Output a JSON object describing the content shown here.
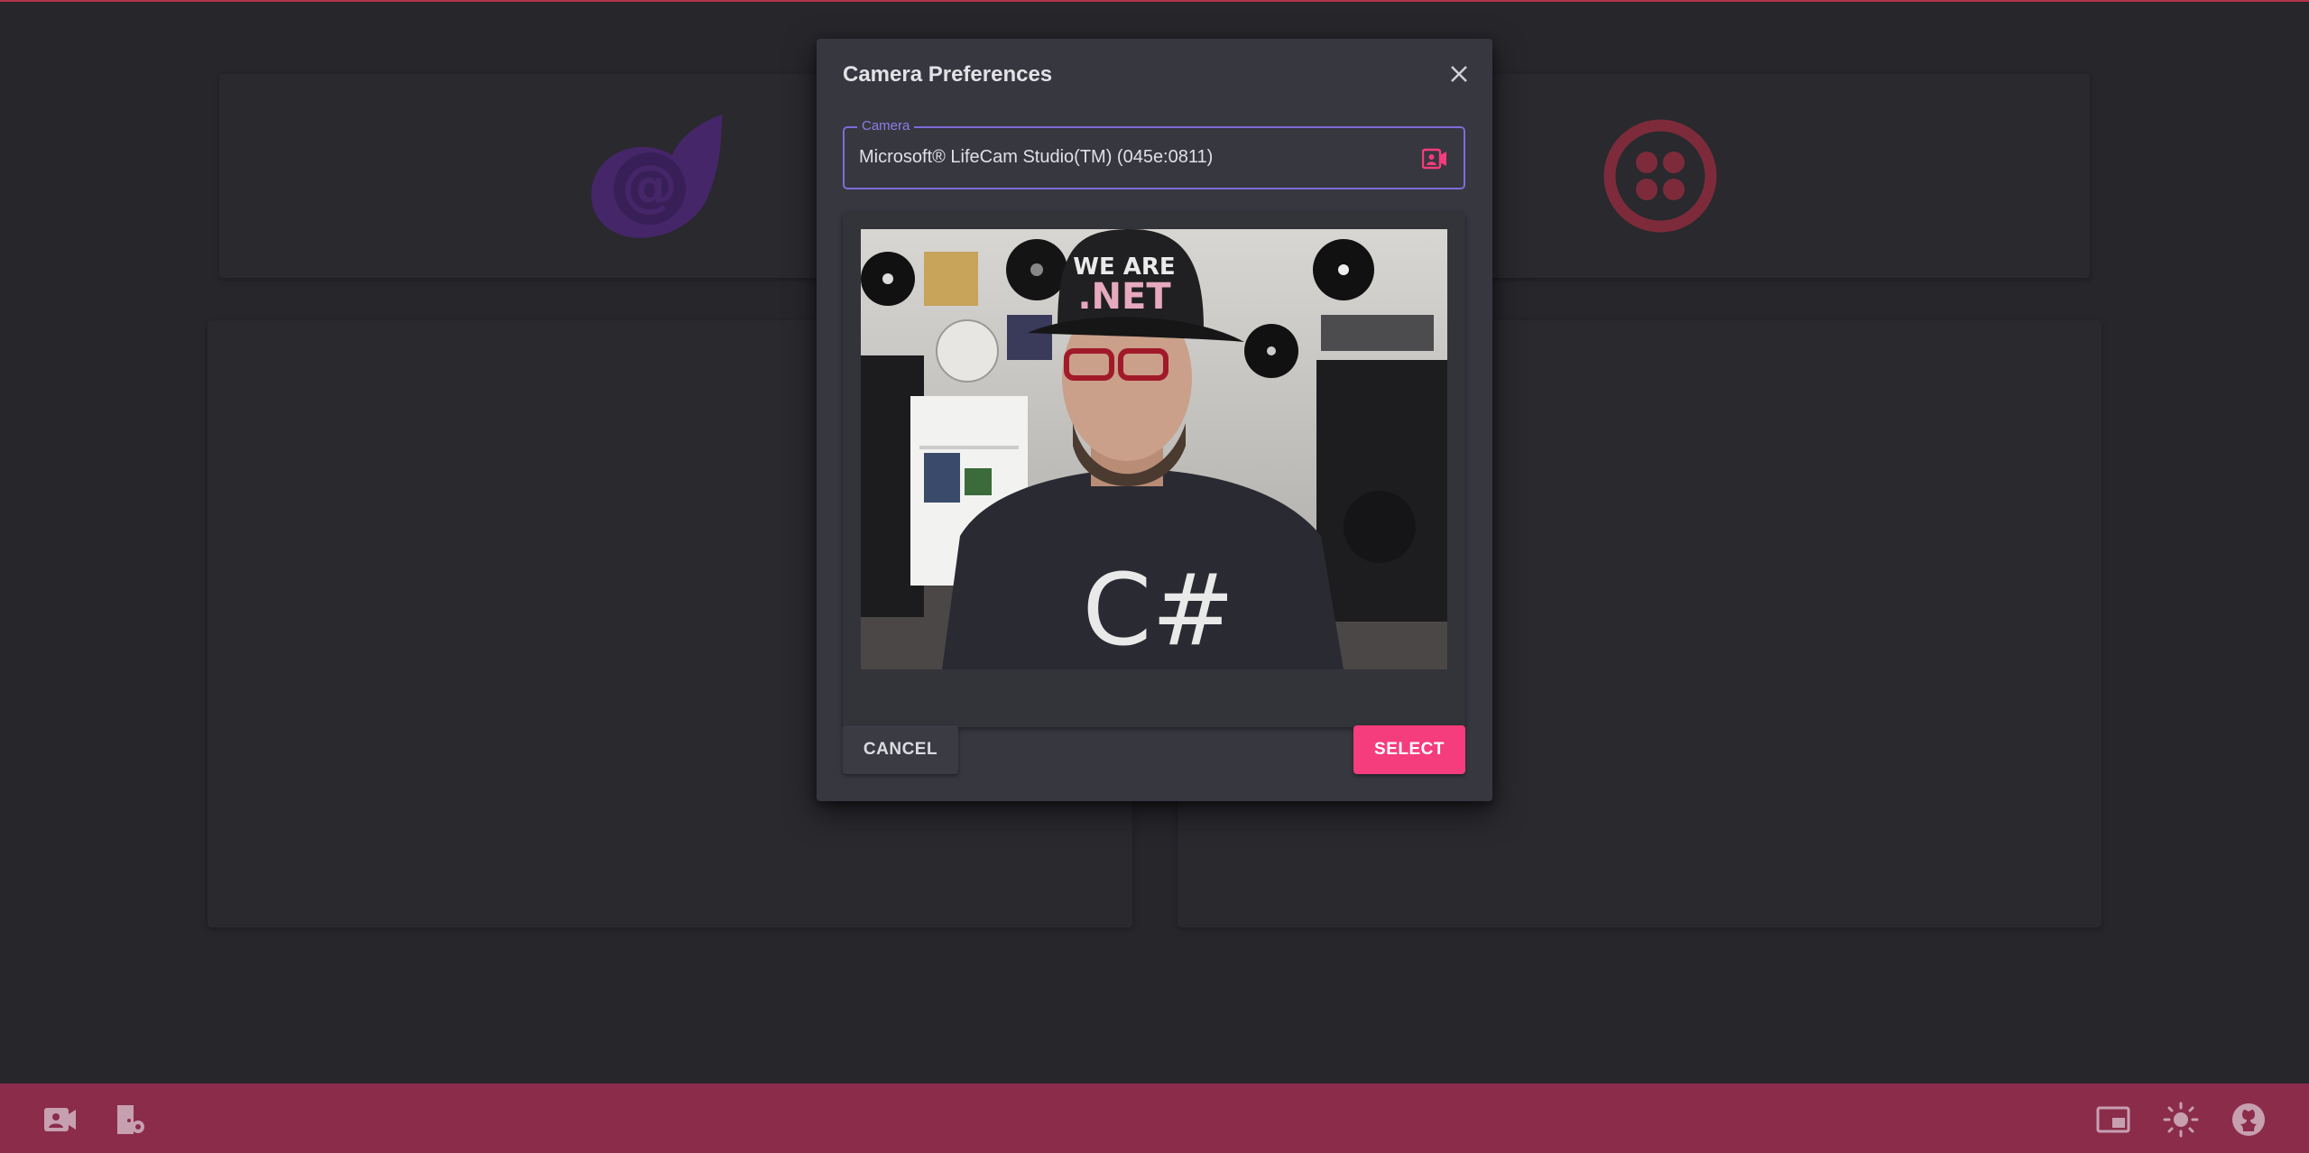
{
  "dialog": {
    "title": "Camera Preferences",
    "close_icon": "close-icon",
    "camera_field": {
      "label": "Camera",
      "value": "Microsoft® LifeCam Studio(TM) (045e:0811)",
      "icon": "video-camera-icon"
    },
    "preview": {
      "description_icon": "camera-preview"
    },
    "buttons": {
      "cancel": "CANCEL",
      "select": "SELECT"
    }
  },
  "appbar": {
    "left_icons": [
      "video-camera-icon",
      "room-settings-icon"
    ],
    "right_icons": [
      "picture-in-picture-icon",
      "brightness-icon",
      "github-icon"
    ]
  },
  "colors": {
    "background": "#2d2d33",
    "card": "#323238",
    "dialog": "#373740",
    "appbar": "#8b2c4b",
    "accent_pink": "#f53c7c",
    "accent_purple": "#7e6bd6",
    "blazor_purple": "#5c2d91",
    "twilio_red": "#b3354a"
  }
}
